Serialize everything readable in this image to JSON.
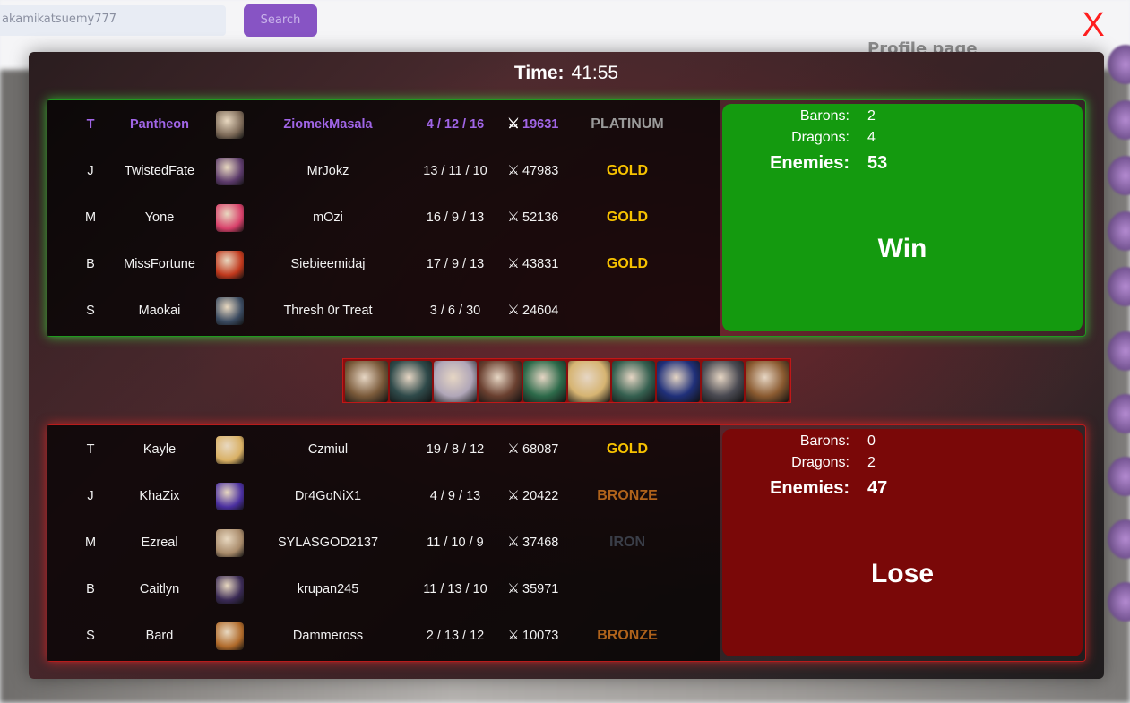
{
  "background": {
    "search_text": "akamikatsuemy777",
    "search_button": "Search",
    "heading": "Profile page"
  },
  "close_label": "X",
  "time": {
    "label": "Time:",
    "value": "41:55"
  },
  "team_blue": {
    "result": "Win",
    "barons_label": "Barons:",
    "barons": "2",
    "dragons_label": "Dragons:",
    "dragons": "4",
    "enemies_label": "Enemies:",
    "enemies": "53",
    "players": [
      {
        "lane": "T",
        "champion": "Pantheon",
        "summoner": "ZiomekMasala",
        "kda": "4 / 12 / 16",
        "cs": "19631",
        "rank": "PLATINUM",
        "rank_color": "#9a9a9a",
        "highlight": true,
        "icon_color": "#7d6a58"
      },
      {
        "lane": "J",
        "champion": "TwistedFate",
        "summoner": "MrJokz",
        "kda": "13 / 11 / 10",
        "cs": "47983",
        "rank": "GOLD",
        "rank_color": "#f7c200",
        "icon_color": "#5b3a6a"
      },
      {
        "lane": "M",
        "champion": "Yone",
        "summoner": "mOzi",
        "kda": "16 / 9 / 13",
        "cs": "52136",
        "rank": "GOLD",
        "rank_color": "#f7c200",
        "icon_color": "#d8406a"
      },
      {
        "lane": "B",
        "champion": "MissFortune",
        "summoner": "Siebieemidaj",
        "kda": "17 / 9 / 13",
        "cs": "43831",
        "rank": "GOLD",
        "rank_color": "#f7c200",
        "icon_color": "#c0381c"
      },
      {
        "lane": "S",
        "champion": "Maokai",
        "summoner": "Thresh 0r Treat",
        "kda": "3 / 6 / 30",
        "cs": "24604",
        "rank": "",
        "rank_color": "#f7c200",
        "icon_color": "#3a4a60"
      }
    ]
  },
  "team_red": {
    "result": "Lose",
    "barons_label": "Barons:",
    "barons": "0",
    "dragons_label": "Dragons:",
    "dragons": "2",
    "enemies_label": "Enemies:",
    "enemies": "47",
    "players": [
      {
        "lane": "T",
        "champion": "Kayle",
        "summoner": "Czmiul",
        "kda": "19 / 8 / 12",
        "cs": "68087",
        "rank": "GOLD",
        "rank_color": "#f7c200",
        "icon_color": "#d9b064"
      },
      {
        "lane": "J",
        "champion": "KhaZix",
        "summoner": "Dr4GoNiX1",
        "kda": "4 / 9 / 13",
        "cs": "20422",
        "rank": "BRONZE",
        "rank_color": "#b0631b",
        "icon_color": "#4a2fa0"
      },
      {
        "lane": "M",
        "champion": "Ezreal",
        "summoner": "SYLASGOD2137",
        "kda": "11 / 10 / 9",
        "cs": "37468",
        "rank": "IRON",
        "rank_color": "#3a3e48",
        "icon_color": "#a88a6a"
      },
      {
        "lane": "B",
        "champion": "Caitlyn",
        "summoner": "krupan245",
        "kda": "11 / 13 / 10",
        "cs": "35971",
        "rank": "",
        "rank_color": "#f7c200",
        "icon_color": "#3a2a55"
      },
      {
        "lane": "S",
        "champion": "Bard",
        "summoner": "Dammeross",
        "kda": "2 / 13 / 12",
        "cs": "10073",
        "rank": "BRONZE",
        "rank_color": "#b0631b",
        "icon_color": "#b06a2a"
      }
    ]
  },
  "bans": [
    {
      "name": "ban-icon",
      "color": "#7a5a3a"
    },
    {
      "name": "ban-icon",
      "color": "#2f4a4a"
    },
    {
      "name": "ban-icon",
      "color": "#b0a6b8"
    },
    {
      "name": "ban-icon",
      "color": "#6a4030"
    },
    {
      "name": "ban-icon",
      "color": "#2d6a4a"
    },
    {
      "name": "ban-icon",
      "color": "#d6b472"
    },
    {
      "name": "ban-icon",
      "color": "#356050"
    },
    {
      "name": "ban-icon",
      "color": "#20307a"
    },
    {
      "name": "ban-icon",
      "color": "#4a4a52"
    },
    {
      "name": "ban-icon",
      "color": "#8a5a30"
    }
  ]
}
